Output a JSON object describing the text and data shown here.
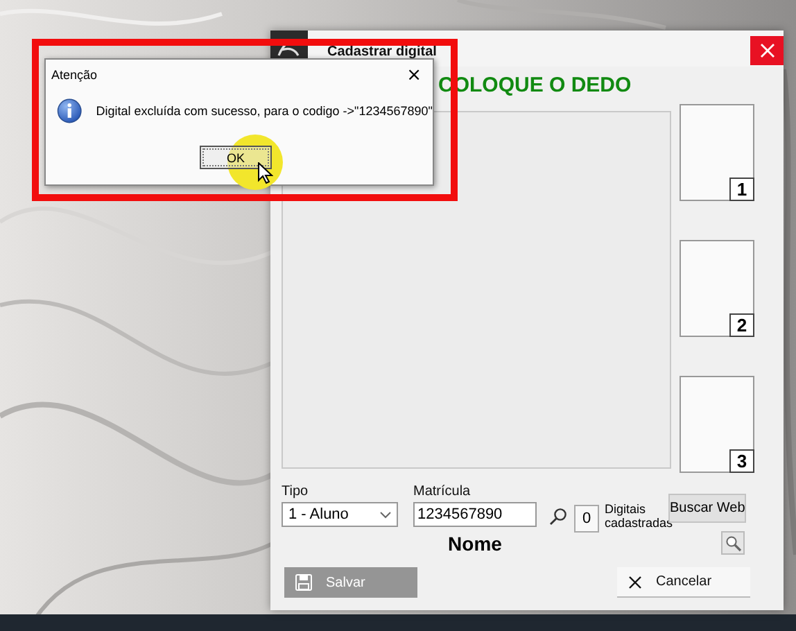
{
  "window": {
    "title": "Cadastrar digital",
    "heading": "COLOQUE O DEDO",
    "slots": [
      {
        "number": "1"
      },
      {
        "number": "2"
      },
      {
        "number": "3"
      }
    ],
    "tipo": {
      "label": "Tipo",
      "value": "1 - Aluno"
    },
    "matricula": {
      "label": "Matrícula",
      "value": "1234567890"
    },
    "count": "0",
    "count_label": "Digitais cadastradas",
    "search_web_button": "Buscar Web",
    "name_label": "Nome",
    "save_button": {
      "label": "Salvar",
      "disabled": true
    },
    "cancel_button": {
      "label": "Cancelar",
      "disabled": false
    }
  },
  "dialog": {
    "title": "Atenção",
    "close": "×",
    "message": "Digital excluída com sucesso, para o codigo ->\"1234567890\"",
    "ok_button": "OK"
  }
}
